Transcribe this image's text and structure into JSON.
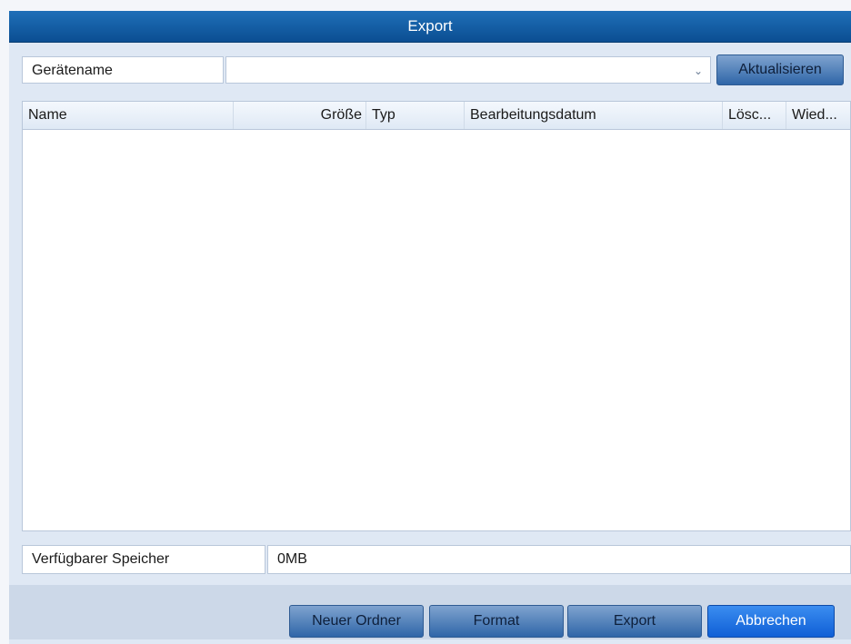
{
  "window": {
    "title": "Export"
  },
  "device": {
    "label": "Gerätename",
    "selected": "",
    "refresh_label": "Aktualisieren"
  },
  "table": {
    "columns": [
      "Name",
      "Größe",
      "Typ",
      "Bearbeitungsdatum",
      "Lösc...",
      "Wied..."
    ],
    "rows": []
  },
  "storage": {
    "label": "Verfügbarer Speicher",
    "value": "0MB"
  },
  "footer": {
    "new_folder_label": "Neuer Ordner",
    "format_label": "Format",
    "export_label": "Export",
    "cancel_label": "Abbrechen"
  },
  "icons": {
    "dropdown": "chevron-down-icon"
  }
}
